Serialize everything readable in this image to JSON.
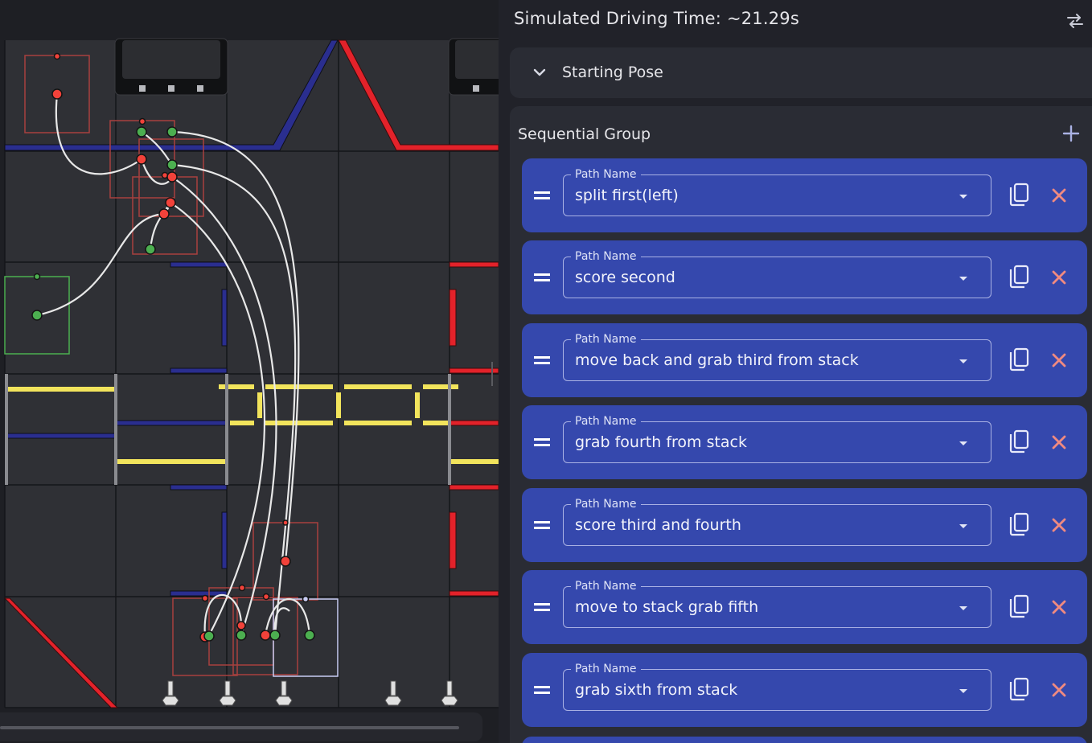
{
  "header": {
    "sim_time": "Simulated Driving Time: ~21.29s",
    "swap_icon": "swap-horizontal-icon"
  },
  "starting_pose": {
    "label": "Starting Pose",
    "expand_icon": "chevron-down-icon"
  },
  "sequential_group": {
    "title": "Sequential Group",
    "add_icon": "plus-icon",
    "field_label": "Path Name",
    "paths": [
      {
        "name": "split first(left)"
      },
      {
        "name": "score second"
      },
      {
        "name": "move back and grab third from stack"
      },
      {
        "name": "grab fourth from stack"
      },
      {
        "name": "score third and fourth"
      },
      {
        "name": "move to stack grab fifth"
      },
      {
        "name": "grab sixth from stack"
      }
    ]
  },
  "colors": {
    "card": "#3548ad",
    "delete": "#f08a80",
    "accent": "#aab2e4",
    "red_alliance": "#e3222a",
    "blue_alliance": "#2a2e8f",
    "tape_yellow": "#f2e45c",
    "path_line": "#e8e8e8",
    "waypoint_green": "#4caf50",
    "waypoint_red": "#f2423a"
  }
}
